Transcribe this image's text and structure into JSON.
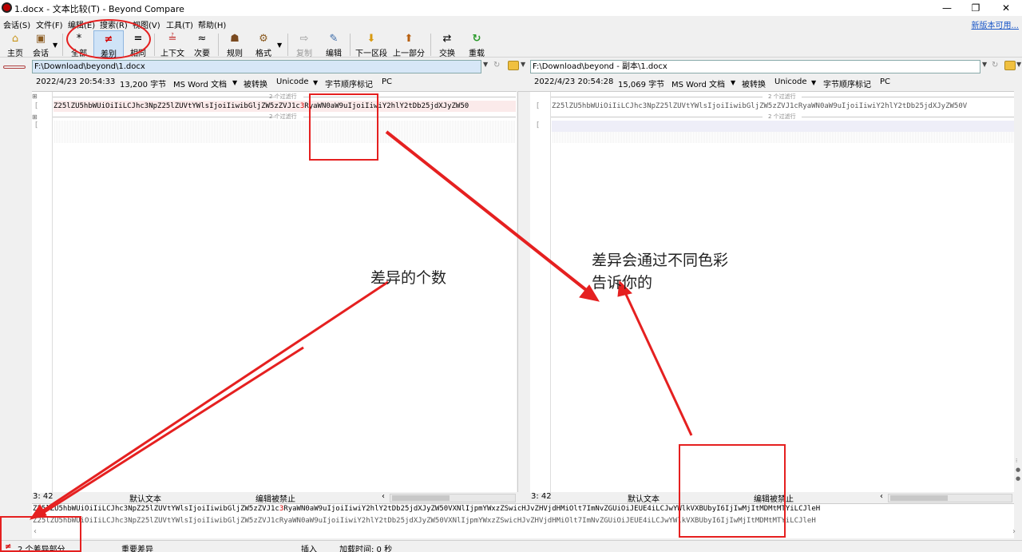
{
  "window": {
    "title": "1.docx - 文本比较(T) - Beyond Compare",
    "minimize": "—",
    "restore": "❐",
    "close": "✕"
  },
  "menu": {
    "items": [
      "会话(S)",
      "文件(F)",
      "编辑(E)",
      "搜索(R)",
      "视图(V)",
      "工具(T)",
      "帮助(H)"
    ],
    "new_version_link": "新版本可用..."
  },
  "toolbar": {
    "buttons": [
      {
        "label": "主页",
        "icon": "home-icon",
        "glyph": "⌂"
      },
      {
        "label": "会话",
        "icon": "session-icon",
        "glyph": "▣"
      },
      {
        "label": "全部",
        "icon": "all-icon",
        "glyph": "*"
      },
      {
        "label": "差别",
        "icon": "diff-icon",
        "glyph": "≠"
      },
      {
        "label": "相同",
        "icon": "same-icon",
        "glyph": "="
      },
      {
        "label": "上下文",
        "icon": "context-icon",
        "glyph": "≟"
      },
      {
        "label": "次要",
        "icon": "minor-icon",
        "glyph": "≈"
      },
      {
        "label": "规则",
        "icon": "rules-icon",
        "glyph": "☗"
      },
      {
        "label": "格式",
        "icon": "format-icon",
        "glyph": "⚙"
      },
      {
        "label": "复制",
        "icon": "copy-icon",
        "glyph": "⇨"
      },
      {
        "label": "编辑",
        "icon": "edit-icon",
        "glyph": "✎"
      },
      {
        "label": "下一区段",
        "icon": "next-section-icon",
        "glyph": "⬇"
      },
      {
        "label": "上一部分",
        "icon": "prev-section-icon",
        "glyph": "⬆"
      },
      {
        "label": "交换",
        "icon": "swap-icon",
        "glyph": "⇄"
      },
      {
        "label": "重载",
        "icon": "reload-icon",
        "glyph": "↻"
      }
    ]
  },
  "left": {
    "path": "F:\\Download\\beyond\\1.docx",
    "date": "2022/4/23 20:54:33",
    "size": "13,200 字节",
    "format": "MS Word 文档",
    "converted": "被转换",
    "encoding": "Unicode",
    "bom": "字节顺序标记",
    "lineend": "PC",
    "fold_top": "2 个过滤行",
    "fold_mid": "2 个过滤行",
    "line_pre": "Z25lZU5hbWUiOiIiLCJhc3NpZ25lZUVtYWlsIjoiIiwibGljZW5zZVJ1c",
    "line_diff": "3",
    "line_post": "RyaWN0aW9uIjoiIiwiY2hlY2tDb25jdXJyZW50",
    "position": "3: 42",
    "mode": "默认文本",
    "edit": "编辑被禁止"
  },
  "right": {
    "path": "F:\\Download\\beyond - 副本\\1.docx",
    "date": "2022/4/23 20:54:28",
    "size": "15,069 字节",
    "format": "MS Word 文档",
    "converted": "被转换",
    "encoding": "Unicode",
    "bom": "字节顺序标记",
    "lineend": "PC",
    "fold_top": "2 个过滤行",
    "fold_mid": "2 个过滤行",
    "line": "Z25lZU5hbWUiOiIiLCJhc3NpZ25lZUVtYWlsIjoiIiwibGljZW5zZVJ1cRyaWN0aW9uIjoiIiwiY2hlY2tDb25jdXJyZW50V",
    "position": "3: 42",
    "mode": "默认文本",
    "edit": "编辑被禁止"
  },
  "compare": {
    "line1_pre": "Z25lZU5hbWUiOiIiLCJhc3NpZ25lZUVtYWlsIjoiIiwibGljZW5zZVJ1c",
    "line1_diff": "3",
    "line1_post": "RyaWN0aW9uIjoiIiwiY2hlY2tDb25jdXJyZW50VXNlIjpmYWxzZSwicHJvZHVjdHMiOlt7ImNvZGUiOiJEUE4iLCJwYWlkVXBUbyI6IjIwMjItMDMtMTYiLCJleH",
    "line2": "Z25lZU5hbWUiOiIiLCJhc3NpZ25lZUVtYWlsIjoiIiwibGljZW5zZVJ1cRyaWN0aW9uIjoiIiwiY2hlY2tDb25jdXJyZW50VXNlIjpmYWxzZSwicHJvZHVjdHMiOlt7ImNvZGUiOiJEUE4iLCJwYWlkVXBUbyI6IjIwMjItMDMtMTYiLCJleH"
  },
  "status": {
    "diff_count": "2 个差异部分",
    "importance": "重要差异",
    "insert": "插入",
    "load_time": "加载时间: 0 秒"
  },
  "annotations": {
    "count_note": "差异的个数",
    "color_note_line1": "差异会通过不同色彩",
    "color_note_line2": "告诉你的"
  },
  "colors": {
    "annotation_red": "#e52020",
    "diff_red": "#d40000",
    "active_toggle": "#cfe3f7"
  }
}
